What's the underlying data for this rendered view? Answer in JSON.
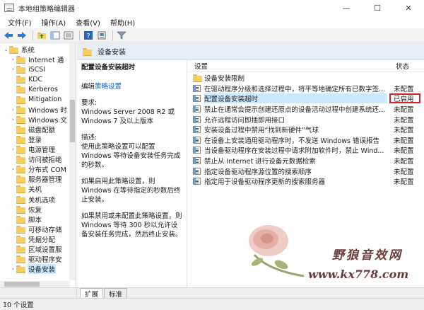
{
  "window": {
    "title": "本地组策略编辑器",
    "min_glyph": "—",
    "max_glyph": "☐",
    "close_glyph": "✕"
  },
  "menu": {
    "items": [
      "文件(F)",
      "操作(A)",
      "查看(V)",
      "帮助(H)"
    ]
  },
  "toolbar": {
    "icons": [
      "back-arrow-icon",
      "forward-arrow-icon",
      "up-folder-icon",
      "show-hide-tree-icon",
      "export-list-icon",
      "help-icon",
      "properties-icon",
      "filter-icon"
    ]
  },
  "tree": {
    "items": [
      {
        "label": "系统",
        "expander": "⌄",
        "indent": 0
      },
      {
        "label": "Internet 通",
        "expander": "›",
        "indent": 1
      },
      {
        "label": "iSCSI",
        "expander": "›",
        "indent": 1
      },
      {
        "label": "KDC",
        "expander": "",
        "indent": 1
      },
      {
        "label": "Kerberos",
        "expander": "",
        "indent": 1
      },
      {
        "label": "Mitigation",
        "expander": "",
        "indent": 1
      },
      {
        "label": "Windows 时",
        "expander": "›",
        "indent": 1
      },
      {
        "label": "Windows 文",
        "expander": "›",
        "indent": 1
      },
      {
        "label": "磁盘配额",
        "expander": "",
        "indent": 1
      },
      {
        "label": "登录",
        "expander": "",
        "indent": 1
      },
      {
        "label": "电源管理",
        "expander": "›",
        "indent": 1
      },
      {
        "label": "访问被拒绝",
        "expander": "",
        "indent": 1
      },
      {
        "label": "分布式 COM",
        "expander": "›",
        "indent": 1
      },
      {
        "label": "服务器管理",
        "expander": "",
        "indent": 1
      },
      {
        "label": "关机",
        "expander": "",
        "indent": 1
      },
      {
        "label": "关机选项",
        "expander": "",
        "indent": 1
      },
      {
        "label": "恢复",
        "expander": "",
        "indent": 1
      },
      {
        "label": "脚本",
        "expander": "",
        "indent": 1
      },
      {
        "label": "可移动存储",
        "expander": "",
        "indent": 1
      },
      {
        "label": "凭据分配",
        "expander": "",
        "indent": 1
      },
      {
        "label": "区域设置服",
        "expander": "",
        "indent": 1
      },
      {
        "label": "驱动程序安",
        "expander": "",
        "indent": 1
      },
      {
        "label": "设备安装",
        "expander": "›",
        "indent": 1,
        "selected": true
      }
    ]
  },
  "header": {
    "title": "设备安装"
  },
  "detail": {
    "heading": "配置设备安装超时",
    "edit_prefix": "编辑",
    "edit_link": "策略设置",
    "requirements_label": "要求:",
    "requirements_text": "Windows Server 2008 R2 或 Windows 7 及以上版本",
    "description_label": "描述:",
    "description_text": "使用此策略设置可以配置 Windows 等待设备安装任务完成的秒数。",
    "enabled_text": "如果启用此策略设置，则 Windows 在等待指定的秒数后终止安装。",
    "disabled_text": "如果禁用或未配置此策略设置，则 Windows 等待 300 秒以允许设备安装任务完成，然后终止安装。"
  },
  "list": {
    "col_setting": "设置",
    "col_state": "状态",
    "rows": [
      {
        "name": "设备安装限制",
        "state": "",
        "type": "folder"
      },
      {
        "name": "在驱动程序分级和选择过程中，将平等地确定所有已数字签...",
        "state": "未配置",
        "type": "policy"
      },
      {
        "name": "配置设备安装超时",
        "state": "已启用",
        "type": "policy",
        "selected": true,
        "highlight": true
      },
      {
        "name": "禁止在通常会提示创建还原点的设备活动过程中创建系统还...",
        "state": "未配置",
        "type": "policy"
      },
      {
        "name": "允许远程访问即插即用接口",
        "state": "未配置",
        "type": "policy"
      },
      {
        "name": "安装设备过程中禁用“找到新硬件”气球",
        "state": "未配置",
        "type": "policy"
      },
      {
        "name": "在设备上安装通用驱动程序时，不发送 Windows 错误报告",
        "state": "未配置",
        "type": "policy"
      },
      {
        "name": "当设备驱动程序在安装过程中请求附加软件时，禁止 Wind...",
        "state": "未配置",
        "type": "policy"
      },
      {
        "name": "禁止从 Internet 进行设备元数据检索",
        "state": "未配置",
        "type": "policy"
      },
      {
        "name": "指定设备驱动程序源位置的搜索顺序",
        "state": "未配置",
        "type": "policy"
      },
      {
        "name": "指定用于设备驱动程序更新的搜索服务器",
        "state": "未配置",
        "type": "policy"
      }
    ]
  },
  "tabs": [
    {
      "label": "扩展",
      "active": true
    },
    {
      "label": "标准",
      "active": false
    }
  ],
  "status": {
    "text": "10 个设置"
  },
  "watermark": {
    "line1": "野狼音效网",
    "line2": "www.kx778.com",
    "colors": {
      "rose": "#e7b4ae",
      "leaf": "#9aa56a"
    }
  }
}
